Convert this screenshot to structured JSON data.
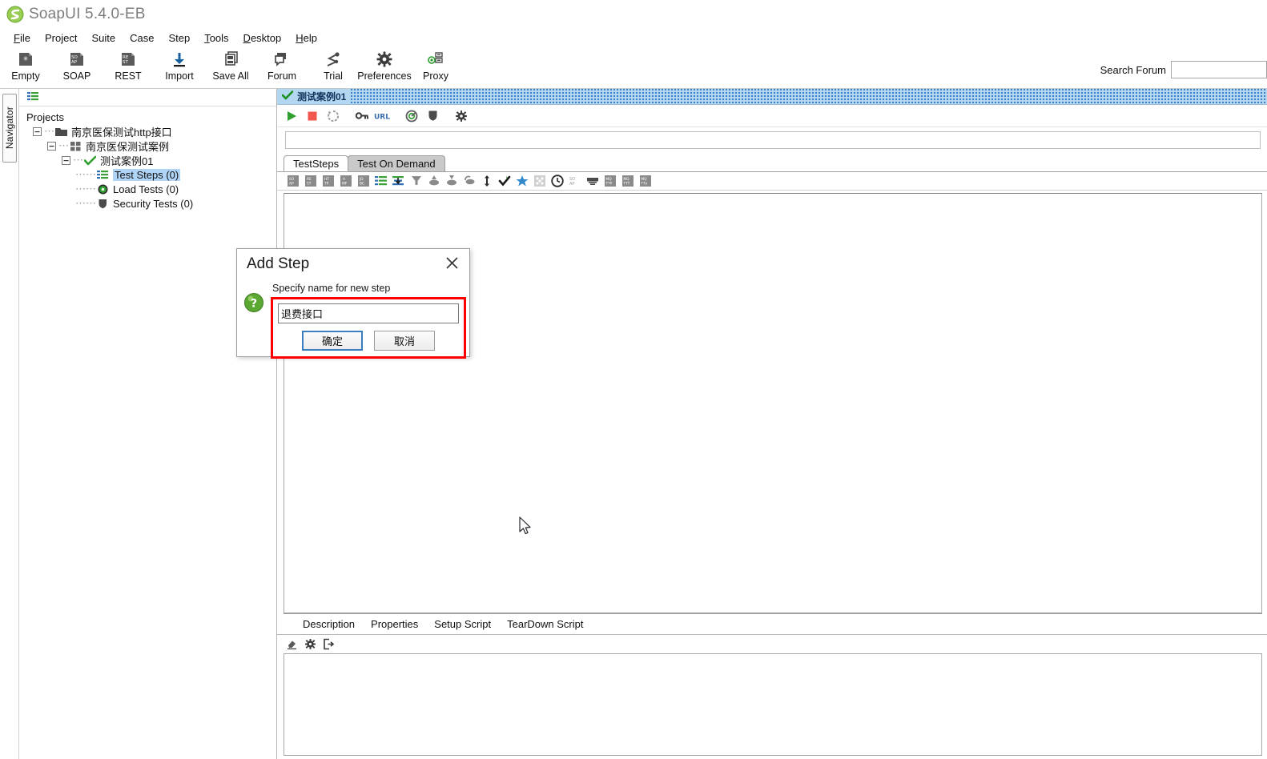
{
  "window": {
    "title": "SoapUI 5.4.0-EB",
    "logo_icon": "soapui-logo-icon"
  },
  "menubar": {
    "items": [
      {
        "label": "File",
        "mnemonic": "F"
      },
      {
        "label": "Project",
        "mnemonic": ""
      },
      {
        "label": "Suite",
        "mnemonic": ""
      },
      {
        "label": "Case",
        "mnemonic": ""
      },
      {
        "label": "Step",
        "mnemonic": ""
      },
      {
        "label": "Tools",
        "mnemonic": "T"
      },
      {
        "label": "Desktop",
        "mnemonic": "D"
      },
      {
        "label": "Help",
        "mnemonic": "H"
      }
    ]
  },
  "toolbar": {
    "buttons": [
      {
        "label": "Empty",
        "icon": "empty-project-icon"
      },
      {
        "label": "SOAP",
        "icon": "soap-project-icon"
      },
      {
        "label": "REST",
        "icon": "rest-project-icon"
      },
      {
        "label": "Import",
        "icon": "import-icon"
      },
      {
        "label": "Save All",
        "icon": "save-all-icon"
      },
      {
        "label": "Forum",
        "icon": "forum-icon"
      },
      {
        "label": "Trial",
        "icon": "trial-icon"
      },
      {
        "label": "Preferences",
        "icon": "gear-icon"
      },
      {
        "label": "Proxy",
        "icon": "proxy-icon"
      }
    ],
    "search_forum_label": "Search Forum",
    "search_forum_value": "",
    "search_forum_placeholder": ""
  },
  "navigator": {
    "tab_label": "Navigator",
    "toolbar_icon": "test-steps-icon",
    "root_label": "Projects",
    "tree": [
      {
        "label": "南京医保测试http接口",
        "icon": "project-folder-icon",
        "depth": 1,
        "expanded": true,
        "selected": false
      },
      {
        "label": "南京医保测试案例",
        "icon": "test-suite-icon",
        "depth": 2,
        "expanded": true,
        "selected": false
      },
      {
        "label": "测试案例01",
        "icon": "test-case-check-icon",
        "depth": 3,
        "expanded": true,
        "selected": false
      },
      {
        "label": "Test Steps (0)",
        "icon": "test-steps-icon",
        "depth": 4,
        "expanded": false,
        "selected": true
      },
      {
        "label": "Load Tests (0)",
        "icon": "load-test-icon",
        "depth": 4,
        "expanded": false,
        "selected": false
      },
      {
        "label": "Security Tests (0)",
        "icon": "security-test-shield-icon",
        "depth": 4,
        "expanded": false,
        "selected": false
      }
    ]
  },
  "testcase_frame": {
    "title": "测试案例01",
    "title_icon": "check-mark-icon",
    "toolbar_buttons": [
      {
        "icon": "run-play-icon",
        "name": "run-testcase-button"
      },
      {
        "icon": "stop-square-icon",
        "name": "stop-testcase-button"
      },
      {
        "icon": "loop-icon",
        "name": "loop-button"
      },
      {
        "icon": "key-icon",
        "name": "properties-button"
      },
      {
        "icon": "url-icon",
        "name": "url-button"
      },
      {
        "icon": "target-icon",
        "name": "coverage-button"
      },
      {
        "icon": "shield-icon",
        "name": "security-button"
      },
      {
        "icon": "gear-icon",
        "name": "options-button"
      }
    ],
    "progress_value": "",
    "tabs": [
      {
        "label": "TestSteps",
        "active": true
      },
      {
        "label": "Test On Demand",
        "active": false
      }
    ],
    "step_toolbar_icons": [
      "soap-request-step-icon",
      "rest-request-step-icon",
      "http-request-step-icon",
      "amf-request-step-icon",
      "jdbc-request-step-icon",
      "properties-step-icon",
      "property-transfer-step-icon",
      "groovy-script-step-icon",
      "datasource-step-icon",
      "datasink-step-icon",
      "dataloop-step-icon",
      "conditional-goto-step-icon",
      "assertion-step-icon",
      "star-step-icon",
      "delay-step-icon",
      "wait-clock-step-icon",
      "soap-mock-response-step-icon",
      "manual-step-icon",
      "mqtt-publish-step-icon",
      "mqtt-receive-step-icon",
      "mqtt-drop-step-icon"
    ],
    "bottom_tabs": [
      {
        "label": "Description"
      },
      {
        "label": "Properties"
      },
      {
        "label": "Setup Script"
      },
      {
        "label": "TearDown Script"
      }
    ],
    "bottom_toolbar_icons": [
      "eraser-icon",
      "gear-icon",
      "export-icon"
    ]
  },
  "dialog": {
    "title": "Add Step",
    "close_icon": "close-icon",
    "help_icon": "question-mark-icon",
    "prompt": "Specify name for new step",
    "input_value": "退费接口",
    "input_placeholder": "",
    "ok_label": "确定",
    "cancel_label": "取消",
    "highlight_color": "#ff0000"
  },
  "colors": {
    "accent_blue": "#b3d7f0",
    "selection_blue": "#b0d4f5",
    "green": "#3fa535",
    "red_highlight": "#ff0000",
    "title_gray": "#7d7d7d"
  }
}
